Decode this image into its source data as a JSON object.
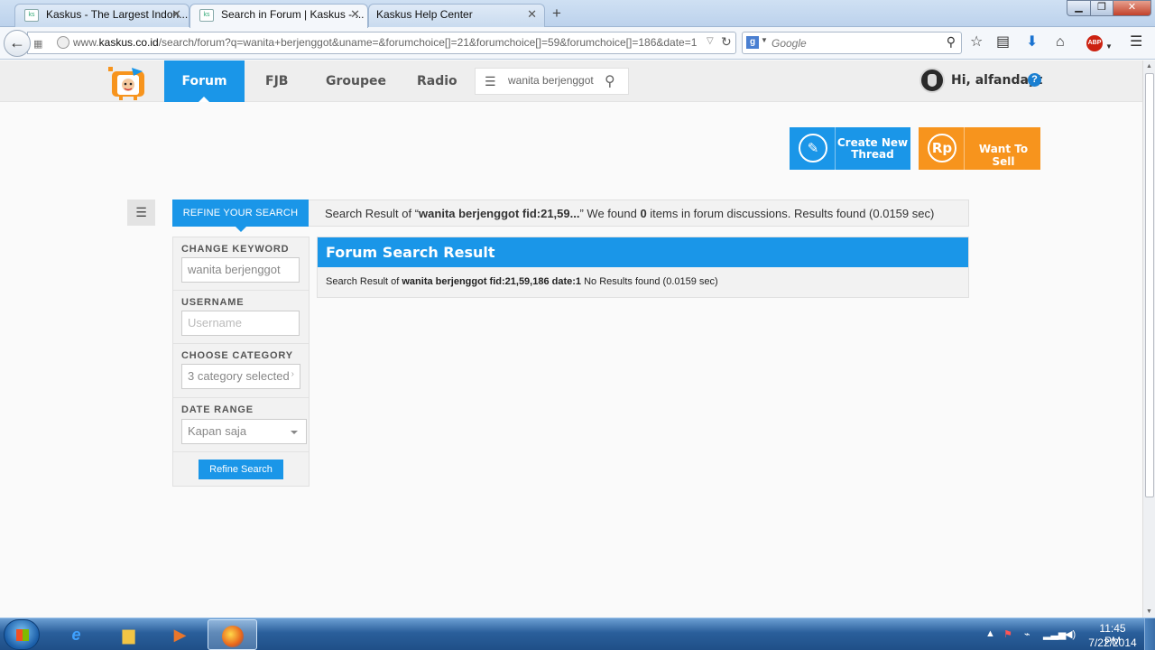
{
  "browser": {
    "tabs": [
      {
        "title": "Kaskus - The Largest Indon...",
        "active": false
      },
      {
        "title": "Search in Forum | Kaskus - ...",
        "active": true
      },
      {
        "title": "Kaskus Help Center",
        "active": false
      }
    ],
    "url_prefix": "www.",
    "url_domain": "kaskus.co.id",
    "url_rest": "/search/forum?q=wanita+berjenggot&uname=&forumchoice[]=21&forumchoice[]=59&forumchoice[]=186&date=1",
    "search_engine_placeholder": "Google",
    "adblock_label": "ABP"
  },
  "kaskus": {
    "nav": {
      "forum": "Forum",
      "fjb": "FJB",
      "groupee": "Groupee",
      "radio": "Radio"
    },
    "header_search_value": "wanita berjenggot",
    "greeting": "Hi, alfandayt",
    "help_symbol": "?",
    "actions": {
      "create_thread": "Create New Thread",
      "want_to_sell": "Want To Sell",
      "sell_icon_text": "Rp"
    },
    "refine": {
      "tab_label": "REFINE YOUR SEARCH",
      "change_keyword_label": "CHANGE KEYWORD",
      "keyword_value": "wanita berjenggot",
      "username_label": "USERNAME",
      "username_placeholder": "Username",
      "category_label": "CHOOSE CATEGORY",
      "category_value": "3 category selected",
      "date_range_label": "DATE RANGE",
      "date_range_value": "Kapan saja",
      "refine_button": "Refine Search"
    },
    "summary": {
      "prefix": "Search Result of “",
      "query": "wanita berjenggot fid:21,59...",
      "mid": "” We found ",
      "count": "0",
      "suffix": " items in forum discussions. Results found (0.0159 sec)"
    },
    "results": {
      "heading": "Forum Search Result",
      "line_prefix": "Search Result of ",
      "line_query": "wanita berjenggot fid:21,59,186 date:1",
      "line_suffix": " No Results found (0.0159 sec)"
    }
  },
  "taskbar": {
    "time": "11:45 PM",
    "date": "7/22/2014"
  },
  "colors": {
    "kaskus_blue": "#1a96e8",
    "kaskus_orange": "#f7941d"
  }
}
